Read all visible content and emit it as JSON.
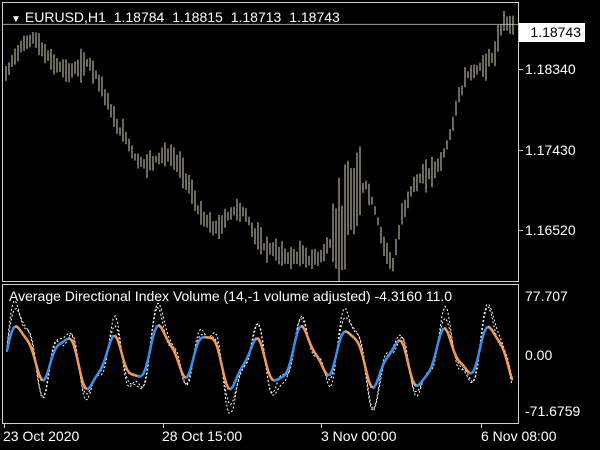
{
  "chart_header": {
    "symbol": "EURUSD,H1",
    "open": "1.18784",
    "high": "1.18815",
    "low": "1.18713",
    "close": "1.18743"
  },
  "current_price": "1.18743",
  "price_axis": [
    "1.18340",
    "1.17430",
    "1.16520"
  ],
  "indicator": {
    "title": "Average Directional Index Volume (14,-1 volume adjusted) -4.3160 11.0",
    "axis": [
      "77.707",
      "0.00",
      "-71.6759"
    ]
  },
  "time_axis": [
    "23 Oct 2020",
    "28 Oct 15:00",
    "3 Nov 00:00",
    "6 Nov 08:00"
  ],
  "colors": {
    "background": "#000000",
    "bars": "#d8d4b4",
    "rising": "#3b8fe8",
    "falling": "#f09a5a",
    "dotted": "#ffffff",
    "grid": "#cfcfcf"
  },
  "chart_data": {
    "type": "line",
    "series": [],
    "y_range": [
      1.1625,
      1.1895
    ],
    "indicator_range": [
      -71.6759,
      77.707
    ],
    "price_path": [
      1.1825,
      1.1845,
      1.1855,
      1.1862,
      1.1848,
      1.1838,
      1.1832,
      1.1828,
      1.1833,
      1.1838,
      1.1822,
      1.18,
      1.1775,
      1.1765,
      1.1745,
      1.1738,
      1.1742,
      1.1748,
      1.1746,
      1.1735,
      1.1715,
      1.169,
      1.168,
      1.1675,
      1.1688,
      1.1695,
      1.169,
      1.167,
      1.1658,
      1.1655,
      1.165,
      1.1647,
      1.165,
      1.1645,
      1.1648,
      1.166,
      1.167,
      1.169,
      1.1705,
      1.172,
      1.1695,
      1.166,
      1.164,
      1.169,
      1.1715,
      1.1725,
      1.173,
      1.1738,
      1.176,
      1.18,
      1.1825,
      1.183,
      1.1835,
      1.1845,
      1.1878,
      1.1874
    ]
  }
}
